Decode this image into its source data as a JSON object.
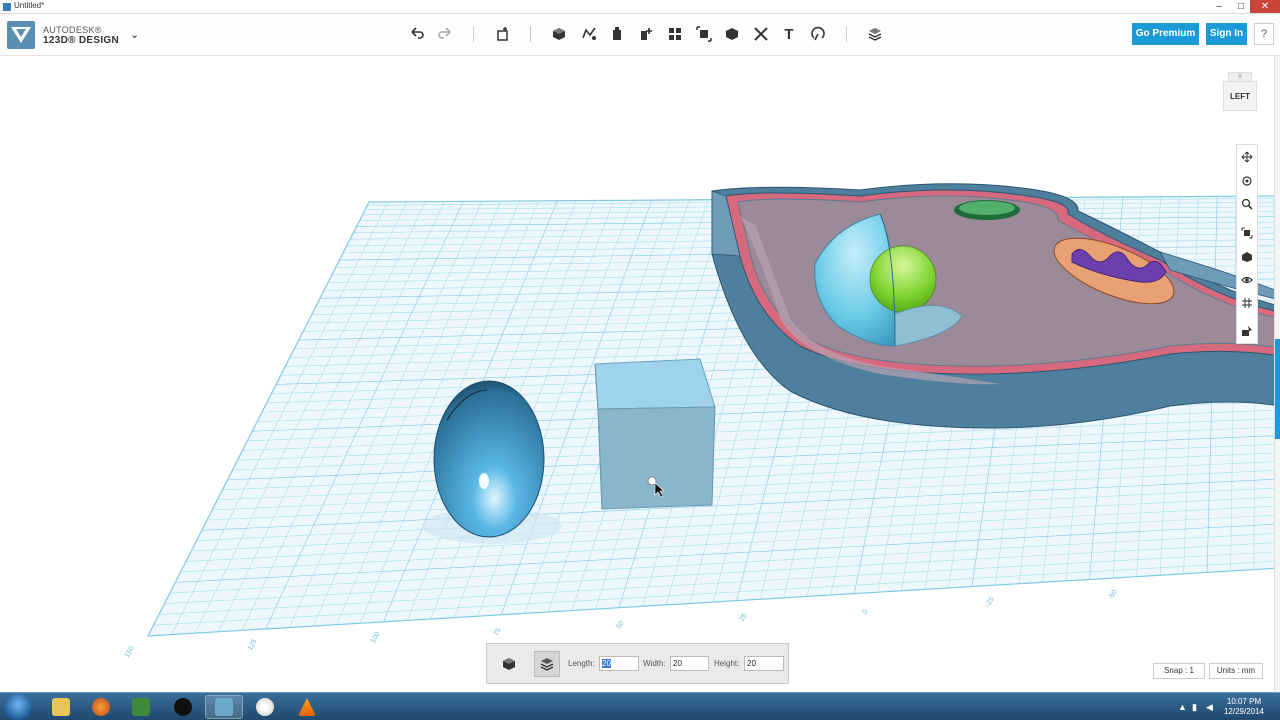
{
  "window": {
    "title": "Untitled*",
    "minimize": "–",
    "maximize": "□",
    "close": "✕"
  },
  "brand": {
    "line1": "AUTODESK®",
    "line2": "123D® DESIGN",
    "menu_chevron": "⌄"
  },
  "toolbar": {
    "tools": [
      {
        "name": "undo",
        "icon": "undo-icon"
      },
      {
        "name": "redo",
        "icon": "redo-icon"
      },
      {
        "name": "transform",
        "icon": "transform-icon"
      },
      {
        "name": "primitives",
        "icon": "primitives-icon"
      },
      {
        "name": "sketch",
        "icon": "sketch-icon"
      },
      {
        "name": "construct",
        "icon": "construct-icon"
      },
      {
        "name": "modify",
        "icon": "modify-icon"
      },
      {
        "name": "pattern",
        "icon": "pattern-icon"
      },
      {
        "name": "grouping",
        "icon": "grouping-icon"
      },
      {
        "name": "combine",
        "icon": "combine-icon"
      },
      {
        "name": "measure",
        "icon": "measure-icon"
      },
      {
        "name": "text",
        "icon": "text-icon",
        "glyph": "T"
      },
      {
        "name": "snap",
        "icon": "snap-icon"
      },
      {
        "name": "material",
        "icon": "material-icon"
      }
    ]
  },
  "header_buttons": {
    "premium": "Go Premium",
    "signin": "Sign In",
    "help": "?"
  },
  "viewcube": {
    "face": "LEFT"
  },
  "grid": {
    "ruler_labels": [
      "150",
      "125",
      "100",
      "75",
      "50",
      "25",
      "0",
      "-25",
      "-50"
    ]
  },
  "dimensions": {
    "length_label": "Length:",
    "length_value": "20",
    "width_label": "Width:",
    "width_value": "20",
    "height_label": "Height:",
    "height_value": "20"
  },
  "status": {
    "snap": "Snap : 1",
    "units": "Units : mm"
  },
  "taskbar": {
    "clock_time": "10:07 PM",
    "clock_date": "12/29/2014",
    "apps": [
      "explorer-icon",
      "firefox-icon",
      "app-icon",
      "obs-icon",
      "123d-design-icon",
      "cd-icon",
      "vlc-icon"
    ]
  },
  "colors": {
    "accent": "#1a9bd7",
    "grid": "#7fc9e6",
    "object": "#6fb1d8"
  }
}
